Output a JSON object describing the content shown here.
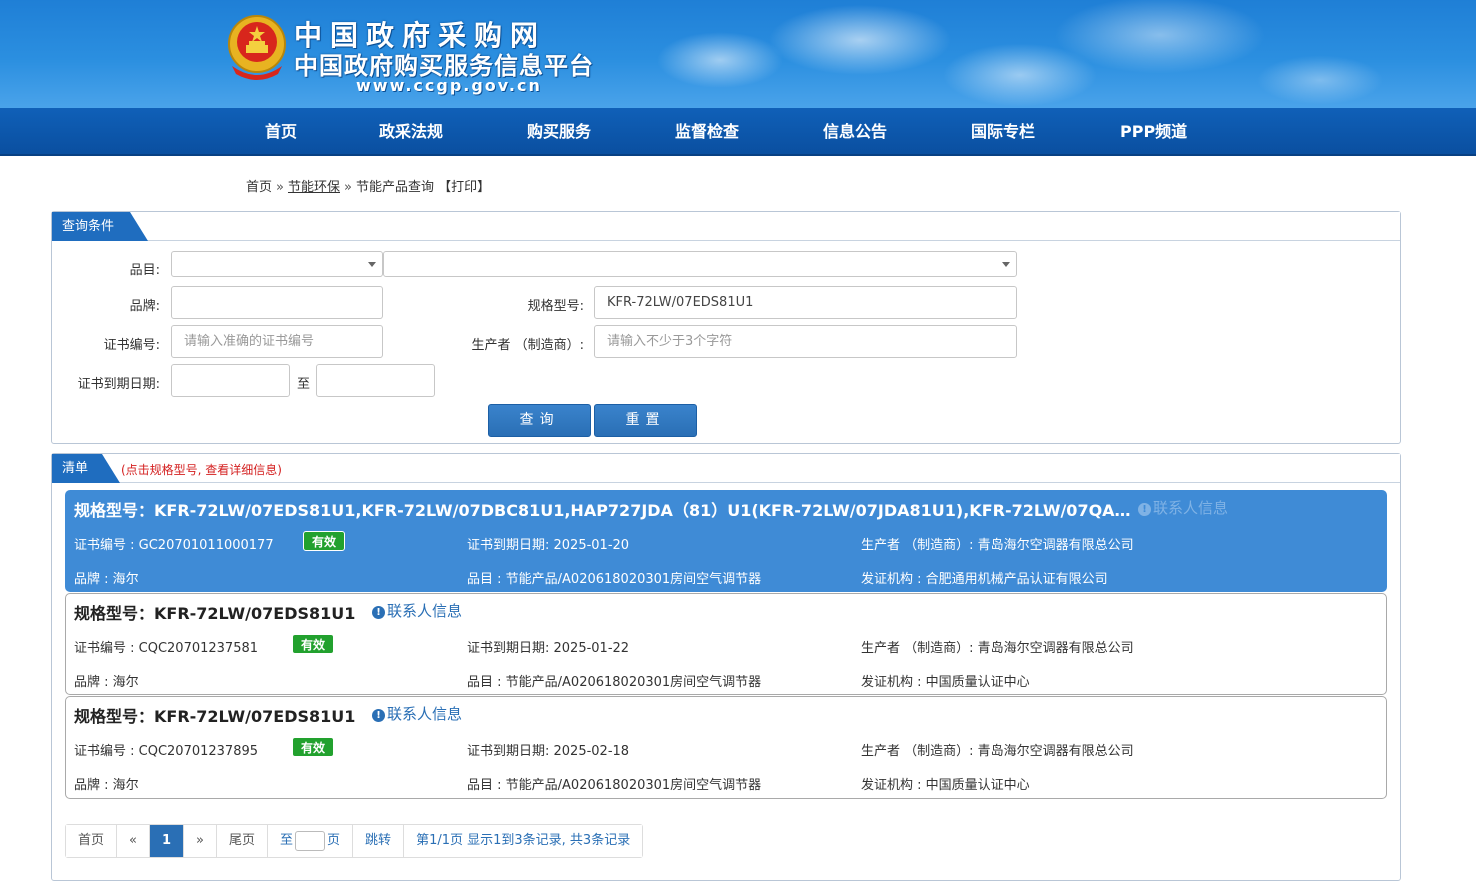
{
  "header": {
    "title": "中国政府采购网",
    "subtitle": "中国政府购买服务信息平台",
    "url": "www.ccgp.gov.cn",
    "emblem_icon": "national-emblem"
  },
  "nav": [
    "首页",
    "政采法规",
    "购买服务",
    "监督检查",
    "信息公告",
    "国际专栏",
    "PPP频道"
  ],
  "breadcrumb": {
    "home": "首页",
    "section": "节能环保",
    "current": "节能产品查询",
    "print": "【打印】",
    "separator": "»"
  },
  "query": {
    "tab_label": "查询条件",
    "category_label": "品目:",
    "category_value": "",
    "subcategory_value": "",
    "brand_label": "品牌:",
    "brand_value": "",
    "model_label": "规格型号:",
    "model_value": "KFR-72LW/07EDS81U1",
    "cert_label": "证书编号:",
    "cert_placeholder": "请输入准确的证书编号",
    "maker_label": "生产者 （制造商）:",
    "maker_placeholder": "请输入不少于3个字符",
    "expiry_label": "证书到期日期:",
    "expiry_to": "至",
    "search_button": "查询",
    "reset_button": "重置"
  },
  "list": {
    "tab_label": "清单",
    "hint": "(点击规格型号, 查看详细信息)",
    "contact_label": "联系人信息",
    "items": [
      {
        "model": "规格型号：KFR-72LW/07EDS81U1,KFR-72LW/07DBC81U1,HAP727JDA（81）U1(KFR-72LW/07JDA81U1),KFR-72LW/07QA…",
        "cert": "证书编号 : GC20701011000177",
        "status": "有效",
        "expiry": "证书到期日期: 2025-01-20",
        "maker": "生产者 （制造商）: 青岛海尔空调器有限总公司",
        "brand": "品牌 : 海尔",
        "category": "品目 : 节能产品/A020618020301房间空气调节器",
        "issuer": "发证机构 : 合肥通用机械产品认证有限公司"
      },
      {
        "model": "规格型号：KFR-72LW/07EDS81U1",
        "cert": "证书编号 : CQC20701237581",
        "status": "有效",
        "expiry": "证书到期日期: 2025-01-22",
        "maker": "生产者 （制造商）: 青岛海尔空调器有限总公司",
        "brand": "品牌 : 海尔",
        "category": "品目 : 节能产品/A020618020301房间空气调节器",
        "issuer": "发证机构 : 中国质量认证中心"
      },
      {
        "model": "规格型号：KFR-72LW/07EDS81U1",
        "cert": "证书编号 : CQC20701237895",
        "status": "有效",
        "expiry": "证书到期日期: 2025-02-18",
        "maker": "生产者 （制造商）: 青岛海尔空调器有限总公司",
        "brand": "品牌 : 海尔",
        "category": "品目 : 节能产品/A020618020301房间空气调节器",
        "issuer": "发证机构 : 中国质量认证中心"
      }
    ]
  },
  "pager": {
    "first": "首页",
    "prev": "«",
    "current": "1",
    "next": "»",
    "last": "尾页",
    "goto_to": "至",
    "goto_page": "页",
    "jump": "跳转",
    "info": "第1/1页  显示1到3条记录, 共3条记录"
  },
  "colors": {
    "header_blue": "#2b8fe0",
    "nav_blue": "#0a4fa0",
    "active_card": "#3f8bd6",
    "valid_green": "#22a12e",
    "hint_red": "#d42020"
  }
}
